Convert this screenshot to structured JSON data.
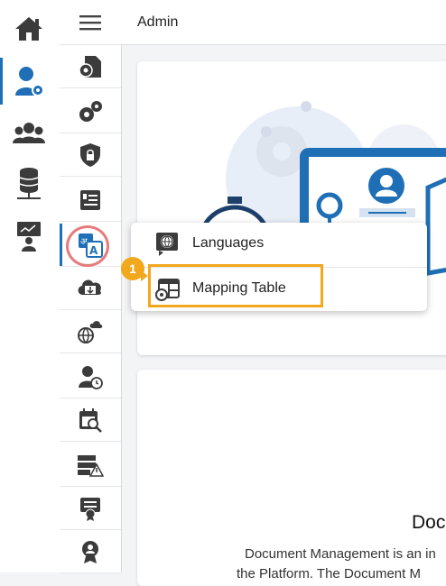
{
  "header": {
    "title": "Admin"
  },
  "popup": {
    "items": [
      {
        "label": "Languages",
        "icon": "globe-document-icon"
      },
      {
        "label": "Mapping Table",
        "icon": "table-gear-icon"
      }
    ]
  },
  "step_badge": "1",
  "main": {
    "card2_title": "Doc",
    "card2_text": "Document Management is an in",
    "card2_text2": "the Platform. The Document M"
  },
  "colors": {
    "accent": "#1f6fb6",
    "highlight": "#f2a81d",
    "ring": "#e77b7b",
    "icon": "#3b3b3b"
  }
}
